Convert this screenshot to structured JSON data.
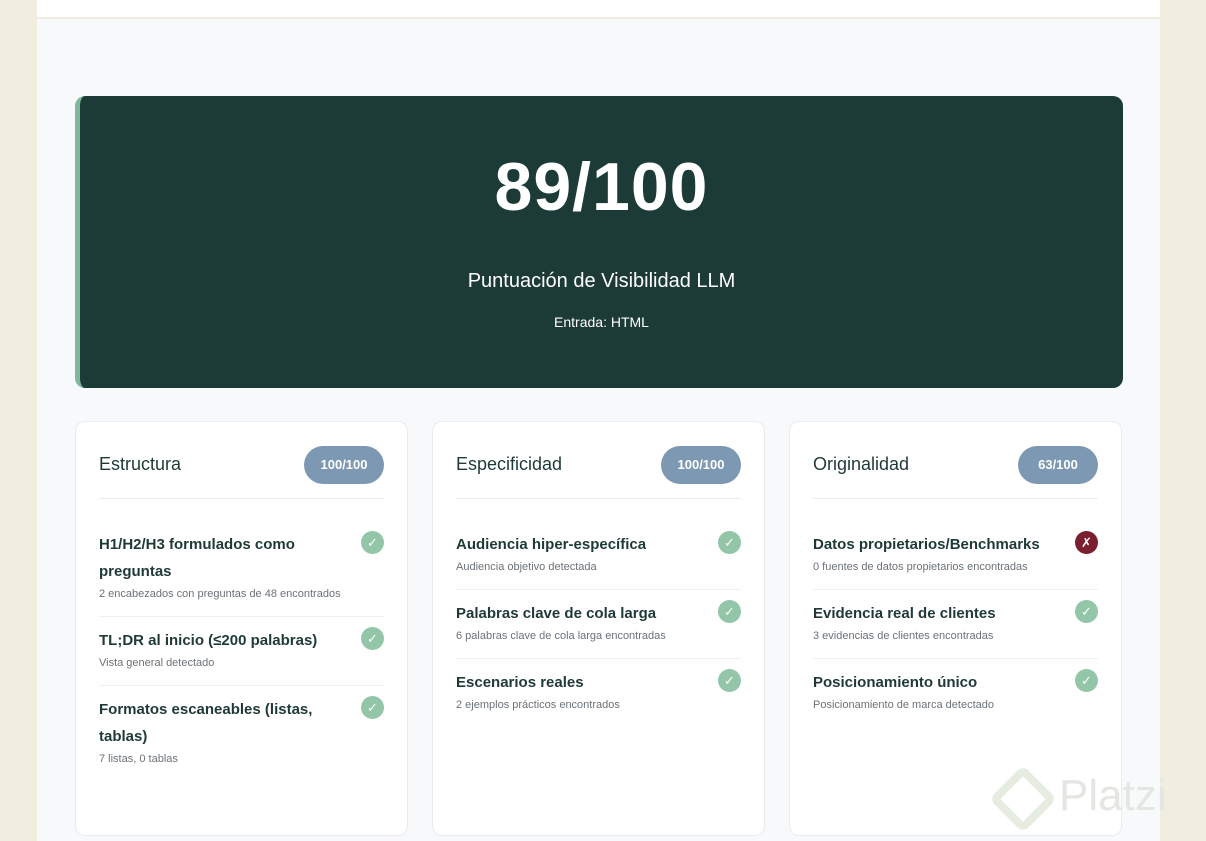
{
  "hero": {
    "score": "89/100",
    "subtitle": "Puntuación de Visibilidad LLM",
    "input": "Entrada: HTML"
  },
  "cards": [
    {
      "title": "Estructura",
      "badge": "100/100",
      "items": [
        {
          "title": "H1/H2/H3 formulados como preguntas",
          "desc": "2 encabezados con preguntas de 48 encontrados",
          "status": "✓"
        },
        {
          "title": "TL;DR al inicio (≤200 palabras)",
          "desc": "Vista general detectado",
          "status": "✓"
        },
        {
          "title": "Formatos escaneables (listas, tablas)",
          "desc": "7 listas, 0 tablas",
          "status": "✓"
        }
      ]
    },
    {
      "title": "Especificidad",
      "badge": "100/100",
      "items": [
        {
          "title": "Audiencia hiper-específica",
          "desc": "Audiencia objetivo detectada",
          "status": "✓"
        },
        {
          "title": "Palabras clave de cola larga",
          "desc": "6 palabras clave de cola larga encontradas",
          "status": "✓"
        },
        {
          "title": "Escenarios reales",
          "desc": "2 ejemplos prácticos encontrados",
          "status": "✓"
        }
      ]
    },
    {
      "title": "Originalidad",
      "badge": "63/100",
      "items": [
        {
          "title": "Datos propietarios/Benchmarks",
          "desc": "0 fuentes de datos propietarios encontradas",
          "status": "✗"
        },
        {
          "title": "Evidencia real de clientes",
          "desc": "3 evidencias de clientes encontradas",
          "status": "✓"
        },
        {
          "title": "Posicionamiento único",
          "desc": "Posicionamiento de marca detectado",
          "status": "✓"
        }
      ]
    }
  ],
  "watermark": {
    "text": "Platzi"
  },
  "colors": {
    "hero_bg": "#1c3b36",
    "accent": "#7fb89d",
    "badge": "#7d98b2",
    "ok": "#93c6a8",
    "fail": "#7a1f2d"
  },
  "icons": {
    "ok": "check-icon",
    "fail": "cross-icon"
  }
}
